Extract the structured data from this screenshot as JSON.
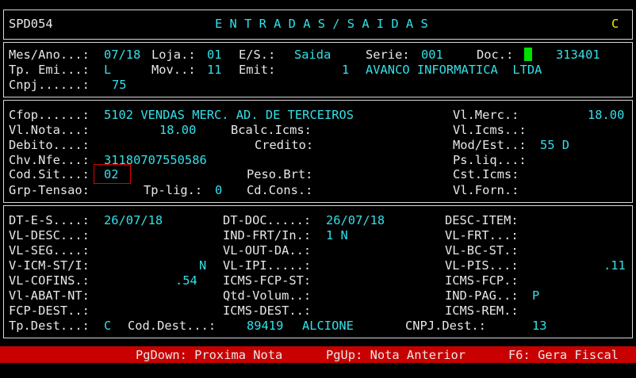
{
  "colors": {
    "background": "#000000",
    "label": "#e8e8e8",
    "value": "#33e0e8",
    "accent": "#f0f000",
    "footer": "#c80000",
    "cursor": "#00e000",
    "highlight": "#e00000"
  },
  "header": {
    "program_code": "SPD054",
    "title": "E N T R A D A S / S A I D A S",
    "mode": "C"
  },
  "section1": {
    "mes_ano_label": "Mes/Ano...:",
    "mes_ano": "07/18",
    "loja_label": "Loja.:",
    "loja": "01",
    "es_label": "E/S.:",
    "es": "Saida",
    "serie_label": "Serie:",
    "serie": "001",
    "doc_label": "Doc.:",
    "doc": "313401",
    "tp_emi_label": "Tp. Emi...:",
    "tp_emi": "L",
    "mov_label": "Mov..:",
    "mov": "11",
    "emit_label": "Emit:",
    "emit_code": "1",
    "emit_name": "AVANCO INFORMATICA  LTDA",
    "cnpj_label": "Cnpj......:",
    "cnpj": "75"
  },
  "section2": {
    "cfop_label": "Cfop......:",
    "cfop": "5102 VENDAS MERC. AD. DE TERCEIROS",
    "vl_merc_label": "Vl.Merc.:",
    "vl_merc": "18.00",
    "vl_nota_label": "Vl.Nota...:",
    "vl_nota": "18.00",
    "bcalc_icms_label": "Bcalc.Icms:",
    "vl_icms_label": "Vl.Icms..:",
    "debito_label": "Debito....:",
    "credito_label": "Credito:",
    "mod_est_label": "Mod/Est..:",
    "mod_est": "55 D",
    "chv_nfe_label": "Chv.Nfe...:",
    "chv_nfe": "31180707550586",
    "ps_liq_label": "Ps.liq...:",
    "cod_sit_label": "Cod.Sit...:",
    "cod_sit": "02",
    "peso_brt_label": "Peso.Brt:",
    "cst_icms_label": "Cst.Icms:",
    "grp_tensao_label": "Grp-Tensao:",
    "tp_lig_label": "Tp-lig.:",
    "tp_lig": "0",
    "cd_cons_label": "Cd.Cons.:",
    "vl_forn_label": "Vl.Forn.:"
  },
  "section3": {
    "dt_es_label": "DT-E-S....:",
    "dt_es": "26/07/18",
    "dt_doc_label": "DT-DOC.....:",
    "dt_doc": "26/07/18",
    "desc_item_label": "DESC-ITEM:",
    "vl_desc_label": "VL-DESC...:",
    "ind_frt_label": "IND-FRT/In.:",
    "ind_frt": "1 N",
    "vl_frt_label": "VL-FRT...:",
    "vl_seg_label": "VL-SEG....:",
    "vl_out_da_label": "VL-OUT-DA..:",
    "vl_bc_st_label": "VL-BC-ST.:",
    "v_icm_st_label": "V-ICM-ST/I:",
    "v_icm_st": "N",
    "vl_ipi_label": "VL-IPI.....:",
    "vl_pis_label": "VL-PIS...:",
    "vl_pis": ".11",
    "vl_cofins_label": "VL-COFINS.:",
    "vl_cofins": ".54",
    "icms_fcp_st_label": "ICMS-FCP-ST:",
    "icms_fcp_label": "ICMS-FCP.:",
    "vl_abat_nt_label": "Vl-ABAT-NT:",
    "qtd_volum_label": "Qtd-Volum..:",
    "ind_pag_label": "IND-PAG..:",
    "ind_pag": "P",
    "fcp_dest_label": "FCP-DEST..:",
    "icms_dest_label": "ICMS-DEST..:",
    "icms_rem_label": "ICMS-REM.:",
    "tp_dest_label": "Tp.Dest...:",
    "tp_dest": "C",
    "cod_dest_label": "Cod.Dest...:",
    "cod_dest": "89419",
    "cod_dest_name": "ALCIONE",
    "cnpj_dest_label": "CNPJ.Dest.:",
    "cnpj_dest": "13"
  },
  "footer": {
    "pgdown": "PgDown: Proxima Nota",
    "pgup": "PgUp: Nota Anterior",
    "f6": "F6: Gera Fiscal"
  }
}
